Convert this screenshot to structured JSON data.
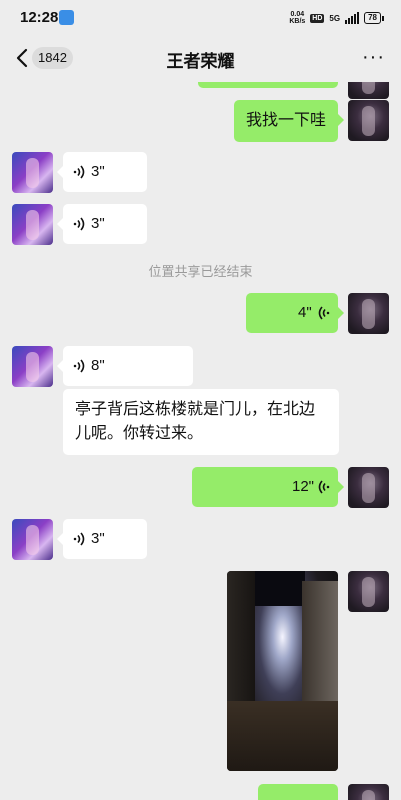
{
  "status_bar": {
    "time": "12:28",
    "net_speed": "0.04",
    "net_unit": "KB/s",
    "hd": "HD",
    "network": "5G",
    "battery": "78"
  },
  "header": {
    "unread_count": "1842",
    "title": "王者荣耀",
    "more": "···"
  },
  "messages": [
    {
      "side": "me",
      "type": "text",
      "text": "我找一下哇"
    },
    {
      "side": "other",
      "type": "voice",
      "duration": "3\""
    },
    {
      "side": "other",
      "type": "voice",
      "duration": "3\""
    },
    {
      "type": "system",
      "text": "位置共享已经结束"
    },
    {
      "side": "me",
      "type": "voice",
      "duration": "4\""
    },
    {
      "side": "other",
      "type": "voice",
      "duration": "8\""
    },
    {
      "side": "other",
      "type": "text",
      "text_lines": [
        "亭子背后这栋楼就是门儿，在北边",
        "儿呢。你转过来。"
      ]
    },
    {
      "side": "me",
      "type": "voice",
      "duration": "12\""
    },
    {
      "side": "other",
      "type": "voice",
      "duration": "3\""
    },
    {
      "side": "me",
      "type": "image",
      "description": ""
    }
  ],
  "colors": {
    "background": "#ededed",
    "my_bubble": "#95ec69",
    "other_bubble": "#ffffff",
    "system_text": "#9a9a9a"
  }
}
